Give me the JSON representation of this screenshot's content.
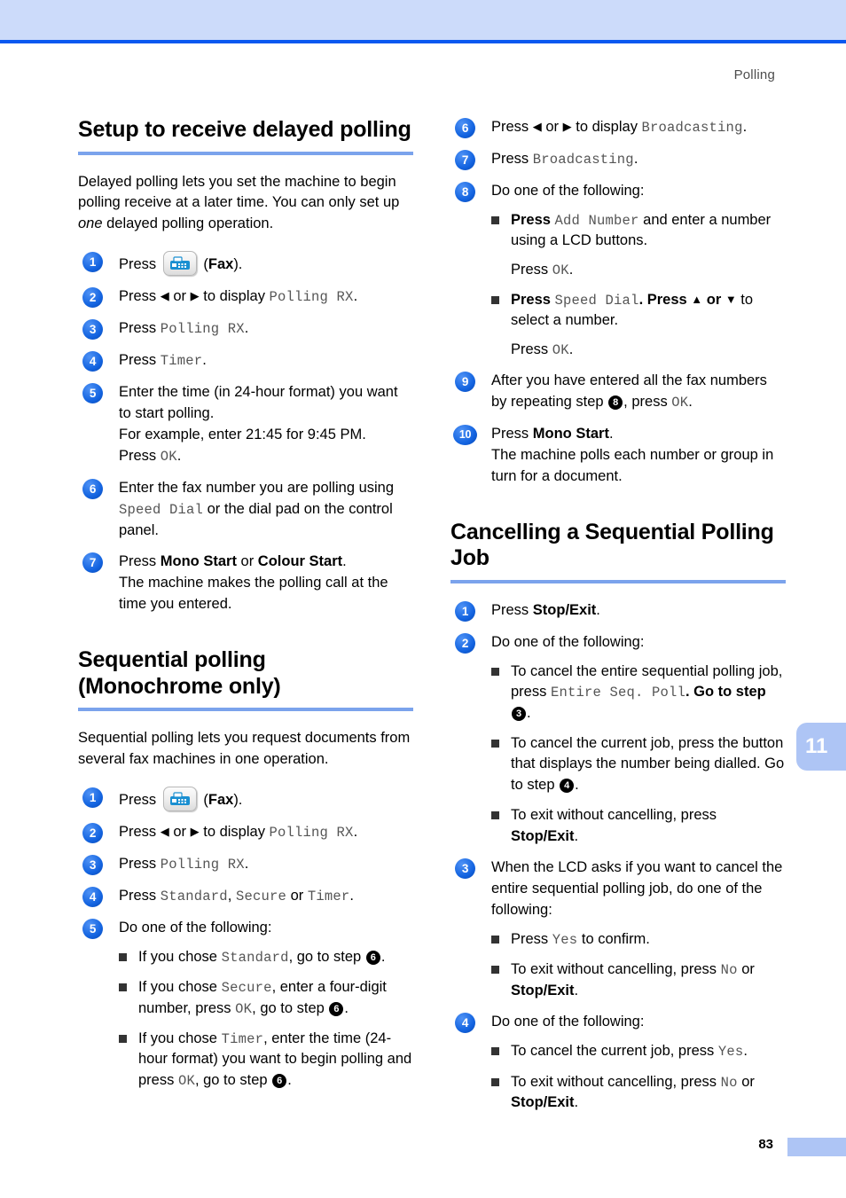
{
  "header": {
    "running_head": "Polling"
  },
  "chapter_tab": "11",
  "footer": {
    "page_number": "83"
  },
  "left_column": {
    "section1": {
      "heading": "Setup to receive delayed polling",
      "intro_a": "Delayed polling lets you set the machine to begin polling receive at a later time. You can only set up ",
      "intro_em": "one",
      "intro_b": " delayed polling operation.",
      "steps": [
        {
          "num": "1",
          "press": "Press",
          "icon": "fax-button-icon",
          "after": "(",
          "bold": "Fax",
          "tail": ")."
        },
        {
          "num": "2",
          "press": "Press",
          "arrow_left": "◀",
          "or": "or",
          "arrow_right": "▶",
          "mid": "to display",
          "lcd": "Polling RX",
          "tail": "."
        },
        {
          "num": "3",
          "press": "Press",
          "lcd": "Polling RX",
          "tail": "."
        },
        {
          "num": "4",
          "press": "Press",
          "lcd": "Timer",
          "tail": "."
        },
        {
          "num": "5",
          "line1": "Enter the time (in 24-hour format) you want to start polling.",
          "line2": "For example, enter 21:45 for 9:45 PM.",
          "line3_press": "Press",
          "line3_lcd": "OK",
          "line3_tail": "."
        },
        {
          "num": "6",
          "pre": "Enter the fax number you are polling using ",
          "lcd": "Speed Dial",
          "post": " or the dial pad on the control panel."
        },
        {
          "num": "7",
          "press": "Press",
          "bold1": "Mono Start",
          "or": " or ",
          "bold2": "Colour Start",
          "tail": ".",
          "line2": "The machine makes the polling call at the time you entered."
        }
      ]
    },
    "section2": {
      "heading": "Sequential polling (Monochrome only)",
      "intro": "Sequential polling lets you request documents from several fax machines in one operation.",
      "steps": [
        {
          "num": "1",
          "press": "Press",
          "icon": "fax-button-icon",
          "after": "(",
          "bold": "Fax",
          "tail": ")."
        },
        {
          "num": "2",
          "press": "Press",
          "arrow_left": "◀",
          "or": "or",
          "arrow_right": "▶",
          "mid": "to display",
          "lcd": "Polling RX",
          "tail": "."
        },
        {
          "num": "3",
          "press": "Press",
          "lcd": "Polling RX",
          "tail": "."
        },
        {
          "num": "4",
          "press": "Press",
          "lcd1": "Standard",
          "comma": ", ",
          "lcd2": "Secure",
          "or": " or ",
          "lcd3": "Timer",
          "tail": "."
        },
        {
          "num": "5",
          "lead": "Do one of the following:",
          "bullets": [
            {
              "pre": "If you chose ",
              "lcd": "Standard",
              "mid": ", go to step ",
              "ref": "6",
              "post": "."
            },
            {
              "pre": "If you chose ",
              "lcd": "Secure",
              "mid": ", enter a four-digit number, press ",
              "lcd2": "OK",
              "mid2": ", go to step ",
              "ref": "6",
              "post": "."
            },
            {
              "pre": "If you chose ",
              "lcd": "Timer",
              "mid": ", enter the time (24-hour format) you want to begin polling and press ",
              "lcd2": "OK",
              "mid2": ", go to step ",
              "ref": "6",
              "post": "."
            }
          ]
        }
      ]
    }
  },
  "right_column": {
    "continued_steps": [
      {
        "num": "6",
        "press": "Press",
        "arrow_left": "◀",
        "or": "or",
        "arrow_right": "▶",
        "mid": "to display",
        "lcd": "Broadcasting",
        "tail": "."
      },
      {
        "num": "7",
        "press": "Press",
        "lcd": "Broadcasting",
        "tail": "."
      },
      {
        "num": "8",
        "lead": "Do one of the following:",
        "bullets": [
          {
            "pre": "Press ",
            "lcd": "Add Number",
            "post": " and enter a number using a LCD buttons.",
            "sub_press": "Press",
            "sub_lcd": "OK",
            "sub_tail": "."
          },
          {
            "pre": "Press ",
            "lcd": "Speed Dial",
            "mid_bold": ". Press ",
            "arrow_up": "▲",
            "or": " or ",
            "arrow_down": "▼",
            "post": " to select a number.",
            "sub_press": "Press",
            "sub_lcd": "OK",
            "sub_tail": "."
          }
        ]
      },
      {
        "num": "9",
        "pre": "After you have entered all the fax numbers by repeating step ",
        "ref": "8",
        "mid": ", press ",
        "lcd": "OK",
        "post": "."
      },
      {
        "num": "10",
        "press": "Press",
        "bold": "Mono Start",
        "tail": ".",
        "line2": "The machine polls each number or group in turn for a document."
      }
    ],
    "section3": {
      "heading": "Cancelling a Sequential Polling Job",
      "steps": [
        {
          "num": "1",
          "press": "Press",
          "bold": "Stop/Exit",
          "tail": "."
        },
        {
          "num": "2",
          "lead": "Do one of the following:",
          "bullets": [
            {
              "pre": "To cancel the entire sequential polling job, press ",
              "lcd": "Entire Seq. Poll",
              "mid": ". Go to step ",
              "ref": "3",
              "post": "."
            },
            {
              "pre": "To cancel the current job, press the button that displays the number being dialled. Go to step ",
              "ref": "4",
              "post": "."
            },
            {
              "pre": "To exit without cancelling, press ",
              "bold": "Stop/Exit",
              "post": "."
            }
          ]
        },
        {
          "num": "3",
          "lead": "When the LCD asks if you want to cancel the entire sequential polling job, do one of the following:",
          "bullets": [
            {
              "pre": "Press ",
              "lcd": "Yes",
              "post": " to confirm."
            },
            {
              "pre": "To exit without cancelling, press ",
              "lcd": "No",
              "mid": " or ",
              "bold": "Stop/Exit",
              "post": "."
            }
          ]
        },
        {
          "num": "4",
          "lead": "Do one of the following:",
          "bullets": [
            {
              "pre": "To cancel the current job, press ",
              "lcd": "Yes",
              "post": "."
            },
            {
              "pre": "To exit without cancelling, press ",
              "lcd": "No",
              "mid": " or ",
              "bold": "Stop/Exit",
              "post": "."
            }
          ]
        }
      ]
    }
  }
}
